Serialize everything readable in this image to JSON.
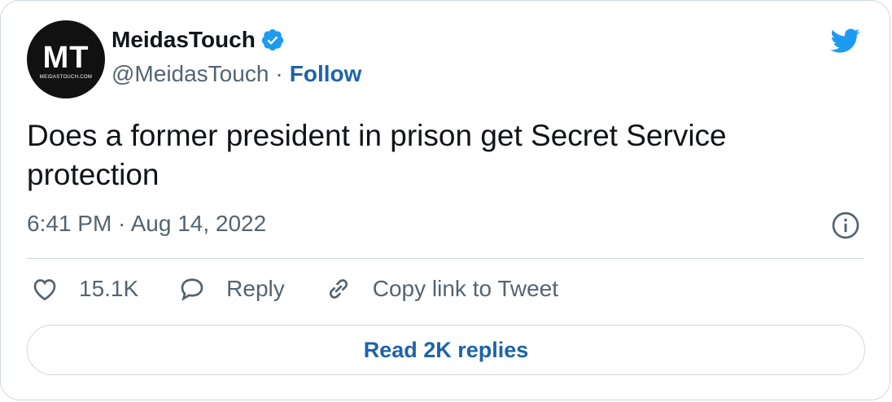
{
  "author": {
    "avatar_monogram": "MT",
    "avatar_subtext": "MEIDASTOUCH.COM",
    "name": "MeidasTouch",
    "verified_icon": "verified-badge-icon",
    "handle": "@MeidasTouch",
    "separator": "·",
    "follow_label": "Follow"
  },
  "brand_icon": "twitter-bird-icon",
  "tweet": {
    "text": "Does a former president in prison get Secret Service protection",
    "timestamp": "6:41 PM · Aug 14, 2022",
    "info_icon": "info-icon"
  },
  "actions": {
    "like_count": "15.1K",
    "reply_label": "Reply",
    "copy_link_label": "Copy link to Tweet"
  },
  "footer": {
    "read_replies_label": "Read 2K replies"
  },
  "colors": {
    "accent": "#1d9bf0",
    "link": "#1d63a8",
    "muted": "#536471",
    "border": "#cfd9de"
  }
}
